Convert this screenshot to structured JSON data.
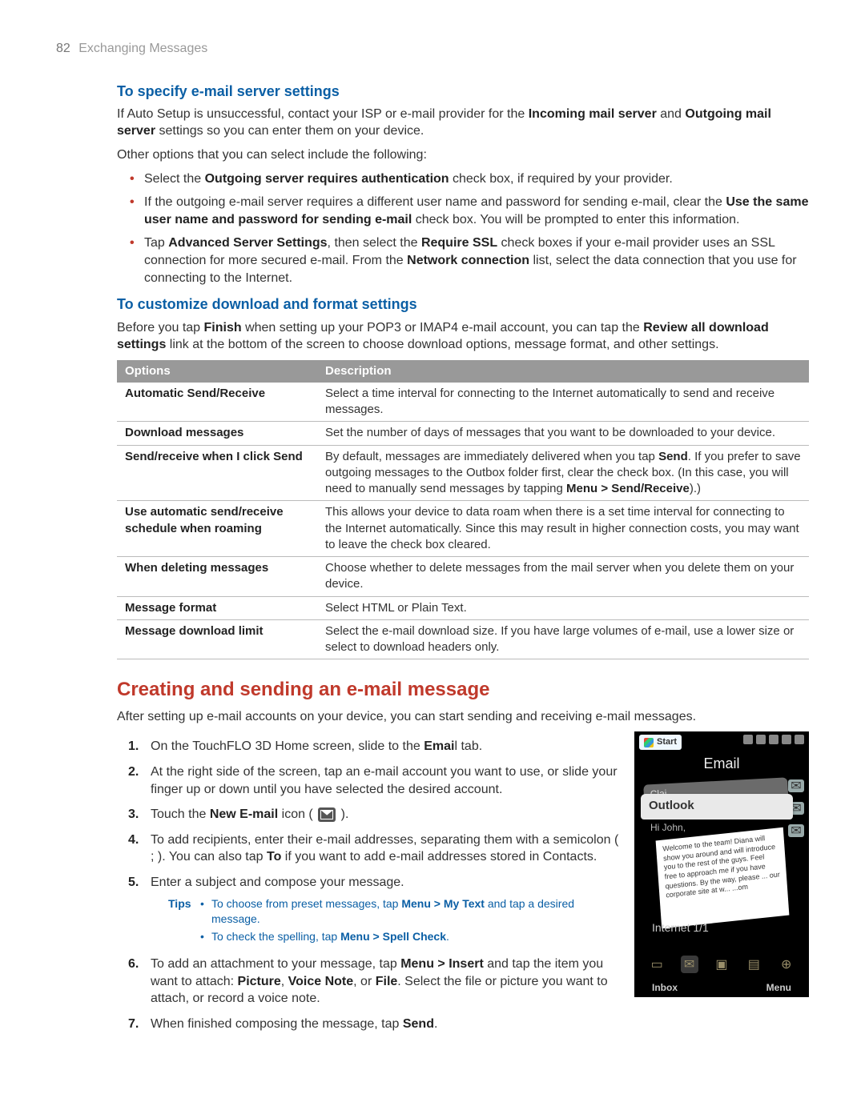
{
  "header": {
    "page_number": "82",
    "section": "Exchanging Messages"
  },
  "sec1": {
    "title": "To specify e-mail server settings",
    "p1_a": "If Auto Setup is unsuccessful, contact your ISP or e-mail provider for the ",
    "p1_b1": "Incoming mail server",
    "p1_mid": " and ",
    "p1_b2": "Outgoing mail server",
    "p1_c": " settings so you can enter them on your device.",
    "p2": "Other options that you can select include the following:",
    "b1_a": "Select the ",
    "b1_b": "Outgoing server requires authentication",
    "b1_c": " check box, if required by your provider.",
    "b2_a": "If the outgoing e-mail server requires a different user name and password for sending e-mail, clear the ",
    "b2_b": "Use the same user name and password for sending e-mail",
    "b2_c": " check box. You will be prompted to enter this information.",
    "b3_a": "Tap ",
    "b3_b": "Advanced Server Settings",
    "b3_c": ", then select the ",
    "b3_d": "Require SSL",
    "b3_e": " check boxes if your e-mail provider uses an SSL connection for more secured e-mail. From the ",
    "b3_f": "Network connection",
    "b3_g": " list, select the data connection that you use for connecting to the Internet."
  },
  "sec2": {
    "title": "To customize download and format settings",
    "p1_a": "Before you tap ",
    "p1_b": "Finish",
    "p1_c": " when setting up your POP3 or IMAP4 e-mail account, you can tap the ",
    "p1_d": "Review all download settings",
    "p1_e": " link at the bottom of the screen to choose download options, message format, and other settings.",
    "th1": "Options",
    "th2": "Description",
    "rows": {
      "r0": {
        "opt": "Automatic Send/Receive",
        "desc": "Select a time interval for connecting to the Internet automatically to send and receive messages."
      },
      "r1": {
        "opt": "Download messages",
        "desc": "Set the number of days of messages that you want to be downloaded to your device."
      },
      "r2": {
        "opt": "Send/receive when I click Send",
        "d_a": "By default, messages are immediately delivered when you tap ",
        "d_b": "Send",
        "d_c": ". If you prefer to save outgoing messages to the Outbox folder first, clear the check box. (In this case, you will need to manually send messages by tapping ",
        "d_d": "Menu > Send/Receive",
        "d_e": ").)"
      },
      "r3": {
        "opt": "Use automatic send/receive schedule when roaming",
        "desc": "This allows your device to data roam when there is a set time interval for connecting to the Internet automatically. Since this may result in higher connection costs, you may want to leave the check box cleared."
      },
      "r4": {
        "opt": "When deleting messages",
        "desc": "Choose whether to delete messages from the mail server when you delete them on your device."
      },
      "r5": {
        "opt": "Message format",
        "desc": "Select HTML or Plain Text."
      },
      "r6": {
        "opt": "Message download limit",
        "desc": "Select the e-mail download size. If you have large volumes of e-mail, use a lower size or select to download headers only."
      }
    }
  },
  "sec3": {
    "title": "Creating and sending an e-mail message",
    "intro": "After setting up e-mail accounts on your device, you can start sending and receiving e-mail messages.",
    "s1_a": "On the TouchFLO 3D Home screen, slide to the ",
    "s1_b": "Emai",
    "s1_c": "l tab.",
    "s2": "At the right side of the screen, tap an e-mail account you want to use, or slide your finger up or down until you have selected the desired account.",
    "s3_a": "Touch the ",
    "s3_b": "New E-mail",
    "s3_c": " icon ( ",
    "s3_d": " ).",
    "s4_a": "To add recipients, enter their e-mail addresses, separating them with a semicolon ( ; ). You can also tap ",
    "s4_b": "To",
    "s4_c": " if you want to add e-mail addresses stored in Contacts.",
    "s5": "Enter a subject and compose your message.",
    "tips_label": "Tips",
    "tip1_a": "To choose from preset messages, tap ",
    "tip1_b": "Menu > My Text",
    "tip1_c": " and tap a desired message.",
    "tip2_a": "To check the spelling, tap ",
    "tip2_b": "Menu > Spell Check",
    "tip2_c": ".",
    "s6_a": "To add an attachment to your message, tap ",
    "s6_b": "Menu > Insert",
    "s6_c": " and tap the item you want to attach: ",
    "s6_d": "Picture",
    "s6_e": ", ",
    "s6_f": "Voice Note",
    "s6_g": ", or ",
    "s6_h": "File",
    "s6_i": ". Select the file or picture you want to attach, or record a voice note.",
    "s7_a": "When finished composing the message, tap ",
    "s7_b": "Send",
    "s7_c": "."
  },
  "shot": {
    "start": "Start",
    "title": "Email",
    "tab_back": "Clai...",
    "tab_front": "Outlook",
    "below": "Hi John,",
    "env_text": "Welcome to the team! Diana will show you around and will introduce you to the rest of the guys. Feel free to approach me if you have questions. By the way, please ... our corporate site at w...   ...om",
    "account": "Internet  1/1",
    "soft_left": "Inbox",
    "soft_right": "Menu"
  }
}
